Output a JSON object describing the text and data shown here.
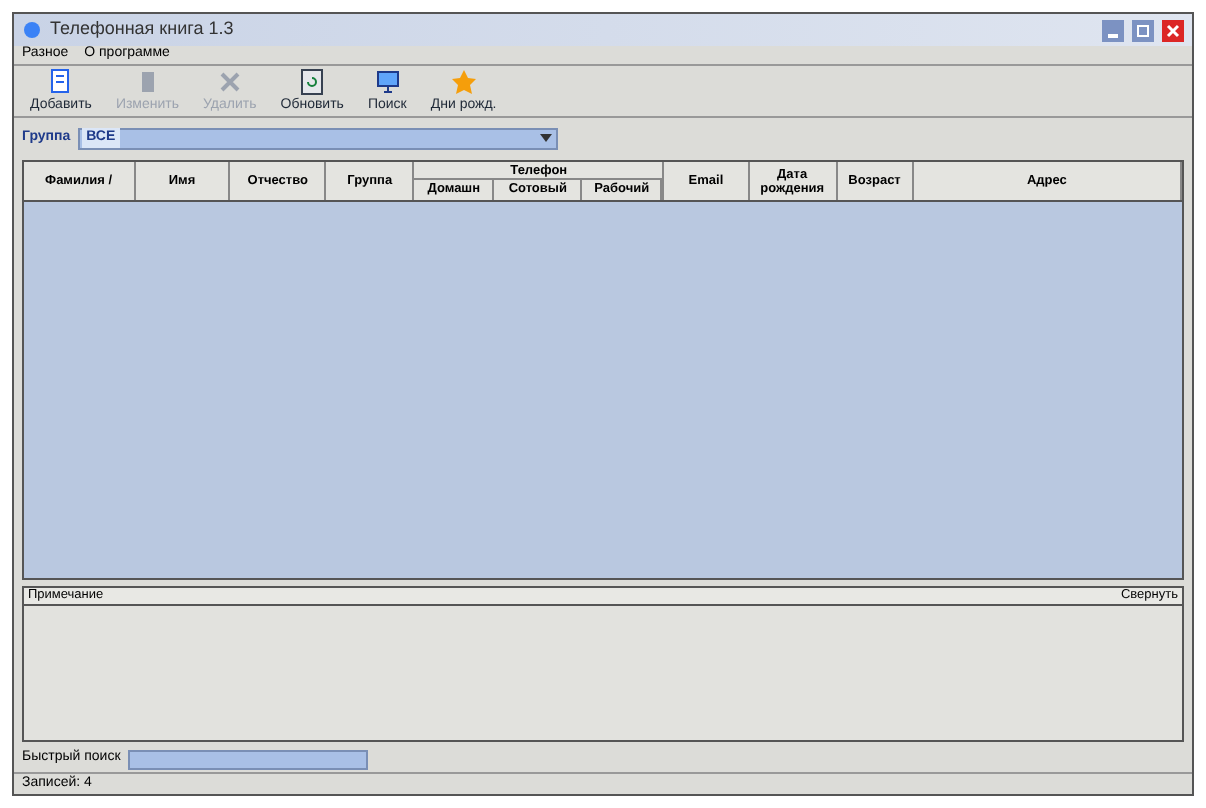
{
  "window": {
    "title": "Телефонная книга 1.3"
  },
  "menu": [
    "Разное",
    "О программе"
  ],
  "toolbar": [
    {
      "label": "Добавить",
      "kind": "add",
      "disabled": false
    },
    {
      "label": "Изменить",
      "kind": "edit",
      "disabled": true
    },
    {
      "label": "Удалить",
      "kind": "delete",
      "disabled": true
    },
    {
      "label": "Обновить",
      "kind": "refresh",
      "disabled": false
    },
    {
      "label": "Поиск",
      "kind": "search",
      "disabled": false
    },
    {
      "label": "Дни рожд.",
      "kind": "birthday",
      "disabled": false
    }
  ],
  "group_filter": {
    "label": "Группа",
    "value": "ВСЕ"
  },
  "table": {
    "columns": [
      {
        "label": "Фамилия /"
      },
      {
        "label": "Имя"
      },
      {
        "label": "Отчество"
      },
      {
        "label": "Группа"
      },
      {
        "label": "Телефон",
        "children": [
          {
            "label": "Домашн"
          },
          {
            "label": "Сотовый"
          },
          {
            "label": "Рабочий"
          }
        ]
      },
      {
        "label": "Email"
      },
      {
        "label": "Дата рождения"
      },
      {
        "label": "Возраст"
      },
      {
        "label": "Адрес"
      }
    ]
  },
  "notes": {
    "label": "Примечание",
    "collapse": "Свернуть"
  },
  "quick_search": {
    "label": "Быстрый поиск"
  },
  "status_bar": "Записей: 4"
}
